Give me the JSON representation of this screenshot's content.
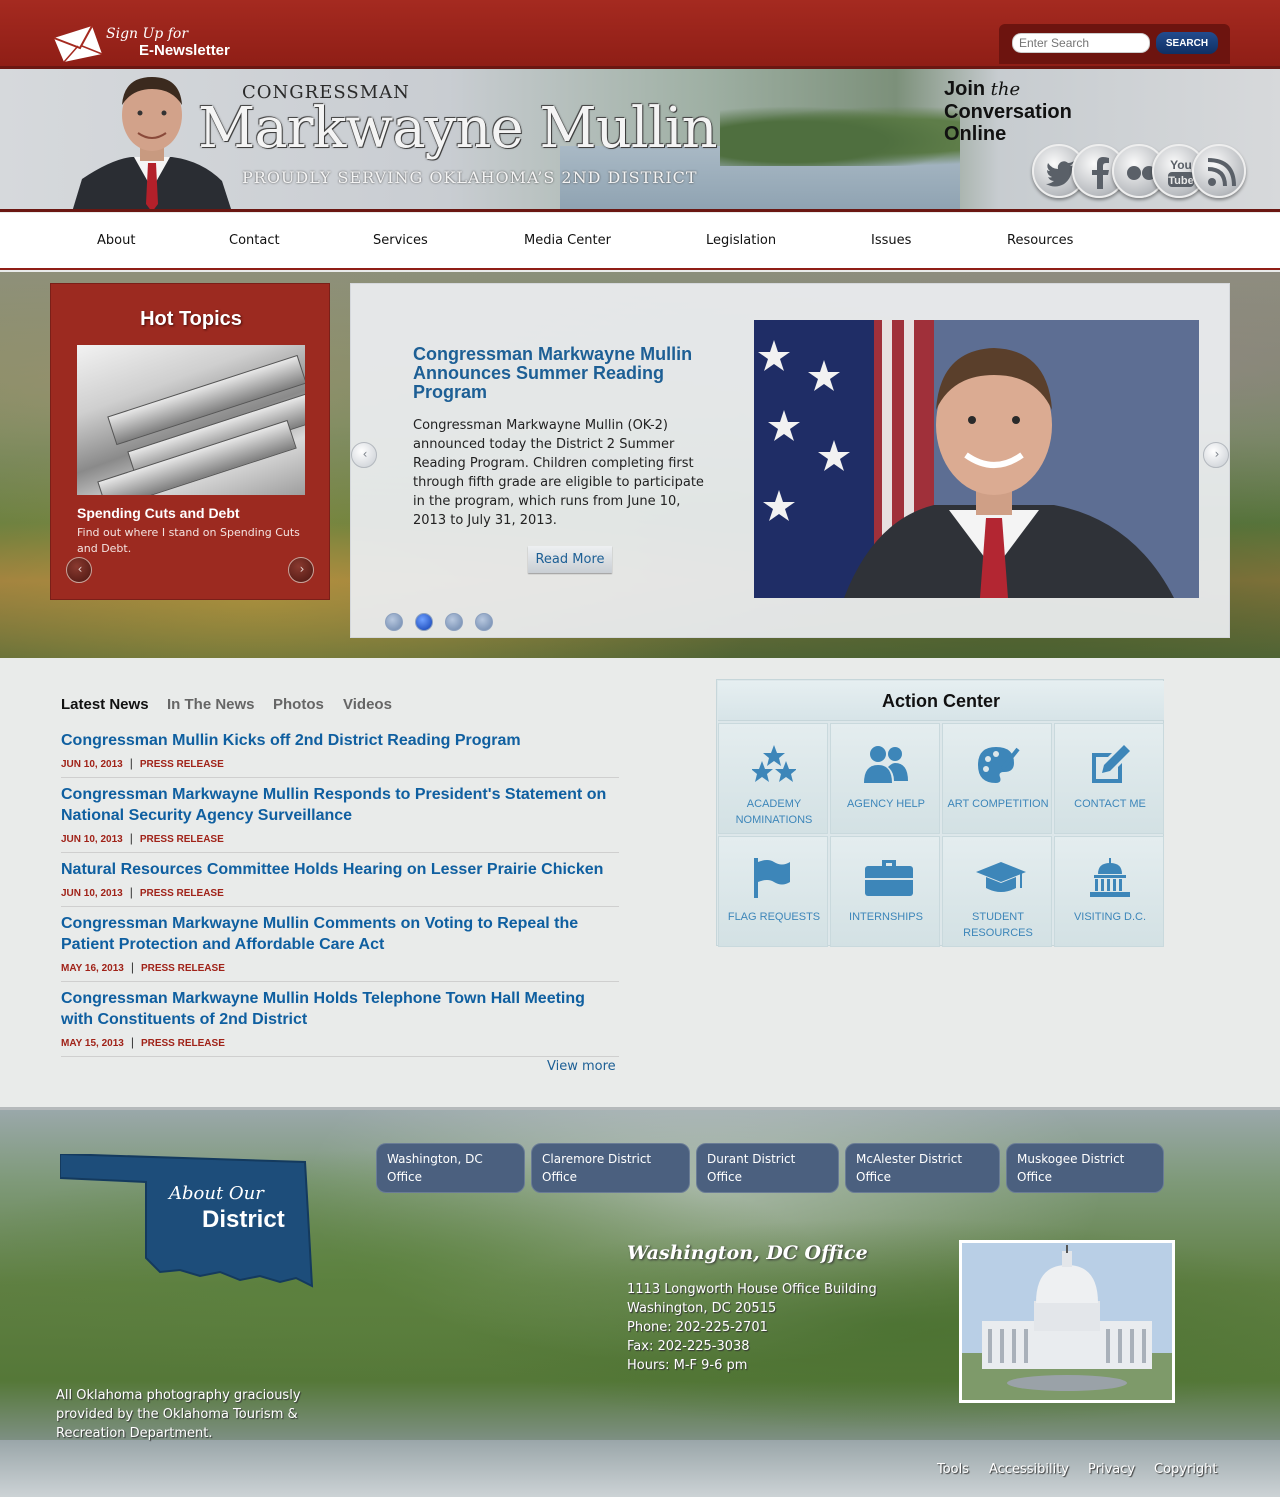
{
  "newsletter": {
    "line1": "Sign Up for",
    "line2": "E-Newsletter"
  },
  "search": {
    "placeholder": "Enter Search",
    "button": "SEARCH"
  },
  "header": {
    "congressman": "CONGRESSMAN",
    "name": "Markwayne Mullin",
    "tagline": "PROUDLY SERVING OKLAHOMA’S 2ND DISTRICT",
    "join_line1_a": "Join ",
    "join_line1_b": "the",
    "join_line2": "Conversation",
    "join_line3": "Online",
    "social_icons": [
      "twitter-icon",
      "facebook-icon",
      "flickr-icon",
      "youtube-icon",
      "rss-icon"
    ],
    "youtube_label": {
      "top": "You",
      "bottom": "Tube"
    }
  },
  "nav": [
    "About",
    "Contact",
    "Services",
    "Media Center",
    "Legislation",
    "Issues",
    "Resources"
  ],
  "hot_topics": {
    "title": "Hot Topics",
    "subtitle": "Spending Cuts and Debt",
    "description": "Find out where I stand on Spending Cuts and Debt.",
    "prev": "‹",
    "next": "›"
  },
  "slider": {
    "title": "Congressman Markwayne Mullin Announces Summer Reading Program",
    "text": "Congressman Markwayne Mullin (OK-2) announced today the District 2 Summer Reading Program. Children completing first through fifth grade are eligible to participate in the program, which runs from June 10, 2013 to July 31, 2013.",
    "read_more": "Read More",
    "prev": "‹",
    "next": "›",
    "slide_count": 4,
    "active_slide": 2
  },
  "news": {
    "tabs": [
      "Latest News",
      "In The News",
      "Photos",
      "Videos"
    ],
    "active_tab": "Latest News",
    "items": [
      {
        "title": "Congressman Mullin Kicks off 2nd District Reading Program",
        "date": "JUN 10, 2013",
        "type": "PRESS RELEASE"
      },
      {
        "title": "Congressman Markwayne Mullin Responds to President's Statement on National Security Agency Surveillance",
        "date": "JUN 10, 2013",
        "type": "PRESS RELEASE"
      },
      {
        "title": "Natural Resources Committee Holds Hearing on Lesser Prairie Chicken",
        "date": "JUN 10, 2013",
        "type": "PRESS RELEASE"
      },
      {
        "title": "Congressman Markwayne Mullin Comments on Voting to Repeal the Patient Protection and Affordable Care Act",
        "date": "MAY 16, 2013",
        "type": "PRESS RELEASE"
      },
      {
        "title": "Congressman Markwayne Mullin Holds Telephone Town Hall Meeting with Constituents of 2nd District",
        "date": "MAY 15, 2013",
        "type": "PRESS RELEASE"
      }
    ],
    "separator": "|",
    "view_more": "View more"
  },
  "action_center": {
    "title": "Action Center",
    "items": [
      {
        "label": "ACADEMY NOMINATIONS",
        "icon": "stars-icon"
      },
      {
        "label": "AGENCY HELP",
        "icon": "people-icon"
      },
      {
        "label": "ART COMPETITION",
        "icon": "palette-icon"
      },
      {
        "label": "CONTACT ME",
        "icon": "edit-icon"
      },
      {
        "label": "FLAG REQUESTS",
        "icon": "flag-icon"
      },
      {
        "label": "INTERNSHIPS",
        "icon": "briefcase-icon"
      },
      {
        "label": "STUDENT RESOURCES",
        "icon": "graduation-cap-icon"
      },
      {
        "label": "VISITING D.C.",
        "icon": "capitol-icon"
      }
    ]
  },
  "footer": {
    "about_line1": "About Our",
    "about_line2": "District",
    "office_tabs": [
      "Washington, DC Office",
      "Claremore District Office",
      "Durant District Office",
      "McAlester District Office",
      "Muskogee District Office"
    ],
    "office": {
      "name": "Washington, DC Office",
      "address1": "1113 Longworth House Office Building",
      "address2": "Washington, DC 20515",
      "phone": "Phone: 202-225-2701",
      "fax": "Fax: 202-225-3038",
      "hours": "Hours: M-F 9-6 pm"
    },
    "photo_credit": "All Oklahoma photography graciously provided by the Oklahoma Tourism & Recreation Department.",
    "links": [
      "Tools",
      "Accessibility",
      "Privacy",
      "Copyright"
    ]
  },
  "colors": {
    "brand_red": "#9c2a20",
    "link_blue": "#0f5fa0",
    "navy_button": "#0f2f63",
    "action_icon_blue": "#3d86b9"
  }
}
